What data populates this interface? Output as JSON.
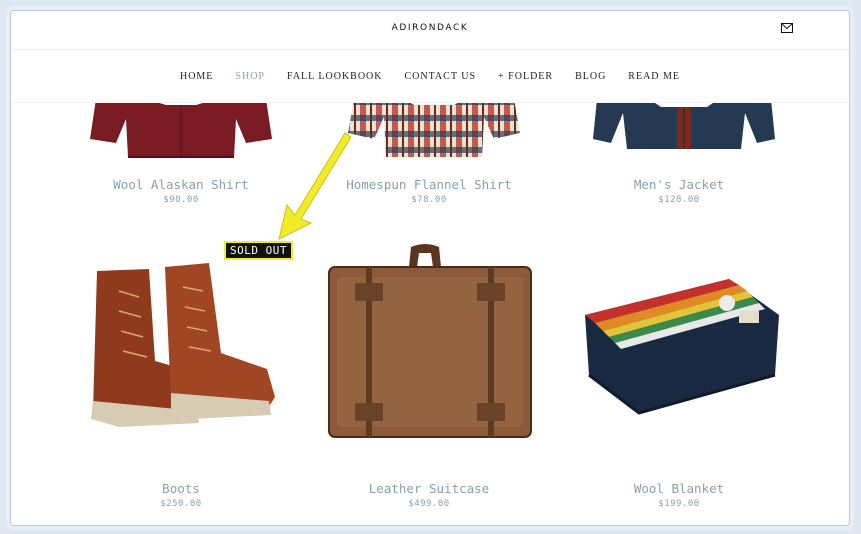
{
  "header": {
    "brand": "ADIRONDACK",
    "mail_icon": "mail-icon"
  },
  "nav": {
    "items": [
      {
        "label": "HOME"
      },
      {
        "label": "SHOP",
        "active": true
      },
      {
        "label": "FALL LOOKBOOK"
      },
      {
        "label": "CONTACT US"
      },
      {
        "label": "+ FOLDER"
      },
      {
        "label": "BLOG"
      },
      {
        "label": "READ ME"
      }
    ]
  },
  "products": [
    {
      "name": "Wool Alaskan Shirt",
      "price": "$90.00"
    },
    {
      "name": "Homespun Flannel Shirt",
      "price": "$78.00"
    },
    {
      "name": "Men's Jacket",
      "price": "$128.00"
    },
    {
      "name": "Boots",
      "price": "$250.00"
    },
    {
      "name": "Leather Suitcase",
      "price": "$499.00"
    },
    {
      "name": "Wool Blanket",
      "price": "$199.00"
    }
  ],
  "sold_out": {
    "label": "SOLD OUT"
  },
  "colors": {
    "accent": "#8aa0ac",
    "highlight": "#f2ec28"
  }
}
